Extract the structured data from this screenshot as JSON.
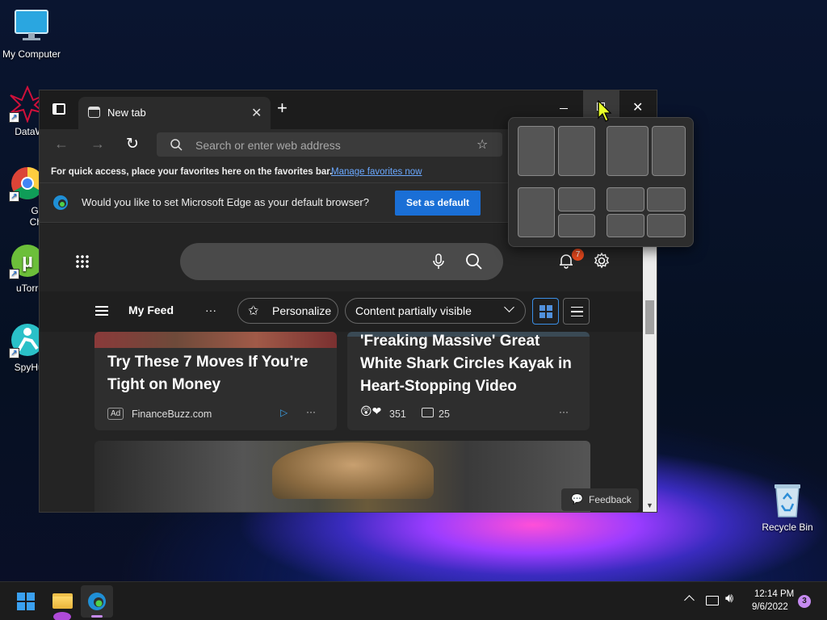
{
  "desktop": {
    "icons": [
      {
        "label": "My Computer"
      },
      {
        "label": "DataWag"
      },
      {
        "label": "Goog Chron"
      },
      {
        "label": "uTorrent"
      },
      {
        "label": "SpyHun"
      },
      {
        "label": "Recycle Bin"
      }
    ]
  },
  "browser": {
    "tab": {
      "title": "New tab"
    },
    "address": {
      "placeholder": "Search or enter web address"
    },
    "favorites_bar": {
      "text": "For quick access, place your favorites here on the favorites bar.",
      "link": "Manage favorites now"
    },
    "default_prompt": {
      "text": "Would you like to set Microsoft Edge as your default browser?",
      "button": "Set as default"
    },
    "notifications": {
      "count": "7"
    },
    "feed": {
      "label": "My Feed",
      "more": "···",
      "personalize": "Personalize",
      "visibility": "Content partially visible",
      "cards": [
        {
          "headline": "Try These 7 Moves If You’re Tight on Money",
          "ad_badge": "Ad",
          "source": "FinanceBuzz.com"
        },
        {
          "headline": "'Freaking Massive' Great White Shark Circles Kayak in Heart-Stopping Video",
          "reactions": "351",
          "comments": "25"
        }
      ],
      "feedback": "Feedback"
    }
  },
  "taskbar": {
    "time": "12:14 PM",
    "date": "9/6/2022",
    "notification_count": "3"
  },
  "colors": {
    "accent": "#1a6fd6",
    "link": "#6aa8ff",
    "badge": "#e8491d"
  }
}
